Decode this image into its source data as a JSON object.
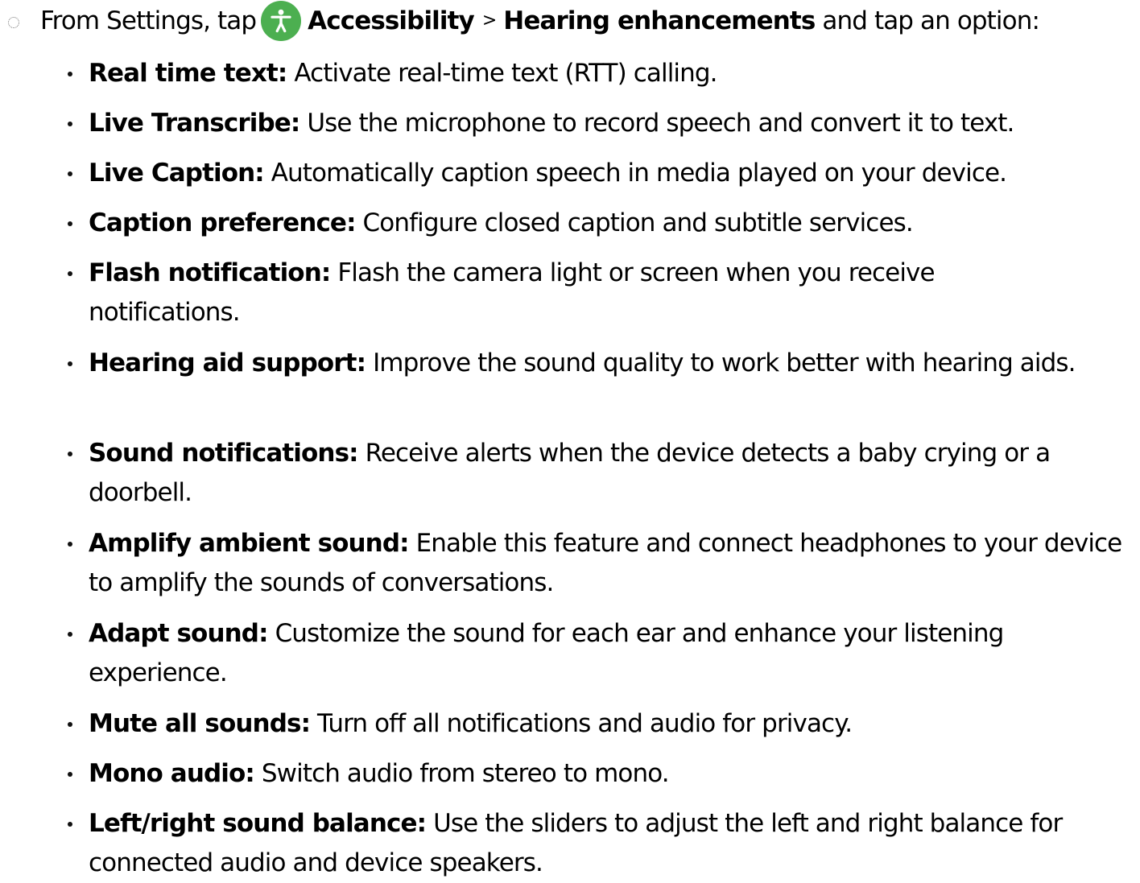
{
  "instruction": {
    "lead": "From Settings, tap",
    "icon": "accessibility-person-icon",
    "icon_color": "#4caf50",
    "menu_path": [
      "Accessibility",
      "Hearing enhancements"
    ],
    "separator": ">",
    "tail": "and tap an option:"
  },
  "options": [
    {
      "term": "Real time text",
      "colon": ":",
      "desc": "Activate real-time text (RTT) calling."
    },
    {
      "term": "Live Transcribe",
      "colon": ":",
      "desc": "Use the microphone to record speech and convert it to text."
    },
    {
      "term": "Live Caption",
      "colon": ":",
      "desc": "Automatically caption speech in media played on your device."
    },
    {
      "term": "Caption preference",
      "colon": ":",
      "desc": "Configure closed caption and subtitle services."
    },
    {
      "term": "Flash notification",
      "colon": ":",
      "desc": "Flash the camera light or screen when you receive notifications."
    },
    {
      "term": "Hearing aid support",
      "colon": ":",
      "desc": "Improve the sound quality to work better with hearing aids."
    },
    {
      "term": "Sound notifications",
      "colon": ":",
      "desc": "Receive alerts when the device detects a baby crying or a doorbell."
    },
    {
      "term": "Amplify ambient sound",
      "colon": ":",
      "desc": "Enable this feature and connect headphones to your device to amplify the sounds of conversations."
    },
    {
      "term": "Adapt sound",
      "colon": ":",
      "desc": "Customize the sound for each ear and enhance your listening experience."
    },
    {
      "term": "Mute all sounds",
      "colon": ":",
      "desc": "Turn off all notifications and audio for privacy."
    },
    {
      "term": "Mono audio",
      "colon": ":",
      "desc": "Switch audio from stereo to mono."
    },
    {
      "term": "Left/right sound balance",
      "colon": ":",
      "desc": "Use the sliders to adjust the left and right balance for connected audio and device speakers."
    }
  ]
}
